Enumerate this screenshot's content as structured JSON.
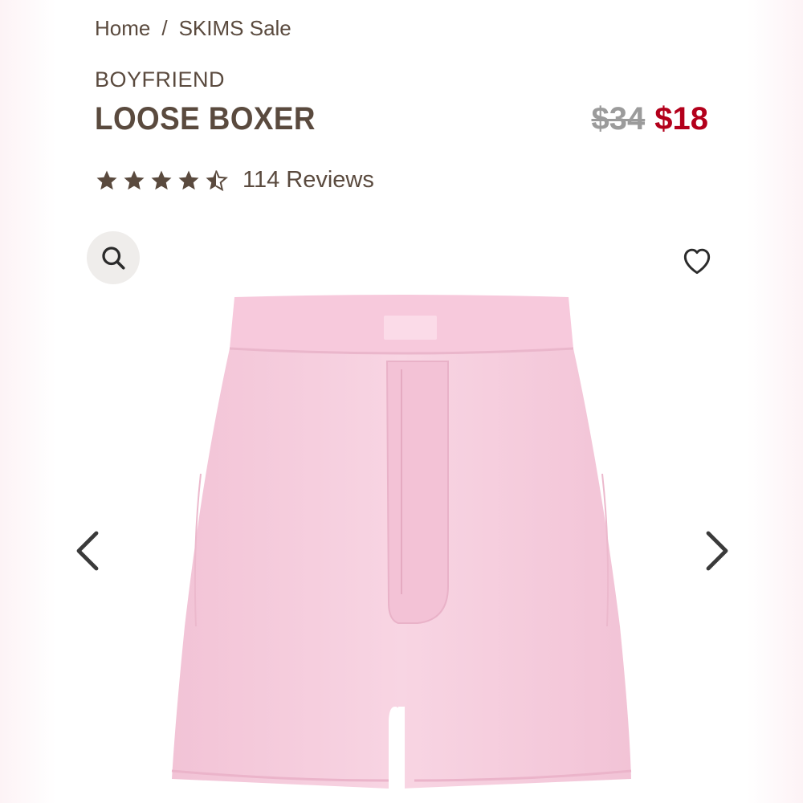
{
  "breadcrumb": {
    "home": "Home",
    "separator": "/",
    "current": "SKIMS Sale"
  },
  "product": {
    "collection": "BOYFRIEND",
    "title": "LOOSE BOXER",
    "price_original": "$34",
    "price_sale": "$18",
    "rating": 4.5,
    "rating_max": 5,
    "reviews": "114 Reviews"
  },
  "gallery": {
    "zoom_icon": "search-icon",
    "wishlist_icon": "heart-outline-icon",
    "prev_icon": "chevron-left-icon",
    "next_icon": "chevron-right-icon",
    "product_color": "#f7cfe0"
  },
  "colors": {
    "text": "#5a4a3e",
    "sale": "#b3001b",
    "strike": "#9b9b9b",
    "icon_bg": "#efedeb"
  }
}
